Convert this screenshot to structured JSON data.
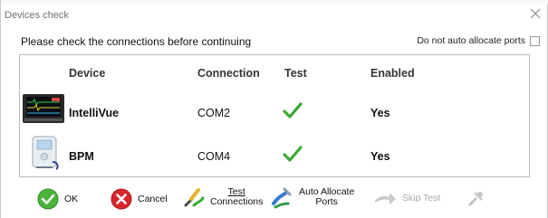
{
  "window": {
    "title": "Devices check"
  },
  "instruction": "Please check the connections before continuing",
  "no_auto_allocate": {
    "label": "Do not auto allocate ports",
    "checked": false
  },
  "table": {
    "headers": [
      "Device",
      "Connection",
      "Test",
      "Enabled"
    ],
    "rows": [
      {
        "device": "IntelliVue",
        "connection": "COM2",
        "test": "ok",
        "enabled": "Yes"
      },
      {
        "device": "BPM",
        "connection": "COM4",
        "test": "ok",
        "enabled": "Yes"
      }
    ]
  },
  "toolbar": {
    "ok": "OK",
    "cancel": "Cancel",
    "test_line1": "Test",
    "test_line2": "Connections",
    "auto_line1": "Auto Allocate",
    "auto_line2": "Ports",
    "skip": "Skip Test"
  },
  "colors": {
    "check_green": "#3aa935",
    "cancel_red": "#d9262a",
    "ok_green": "#4ab43a"
  }
}
